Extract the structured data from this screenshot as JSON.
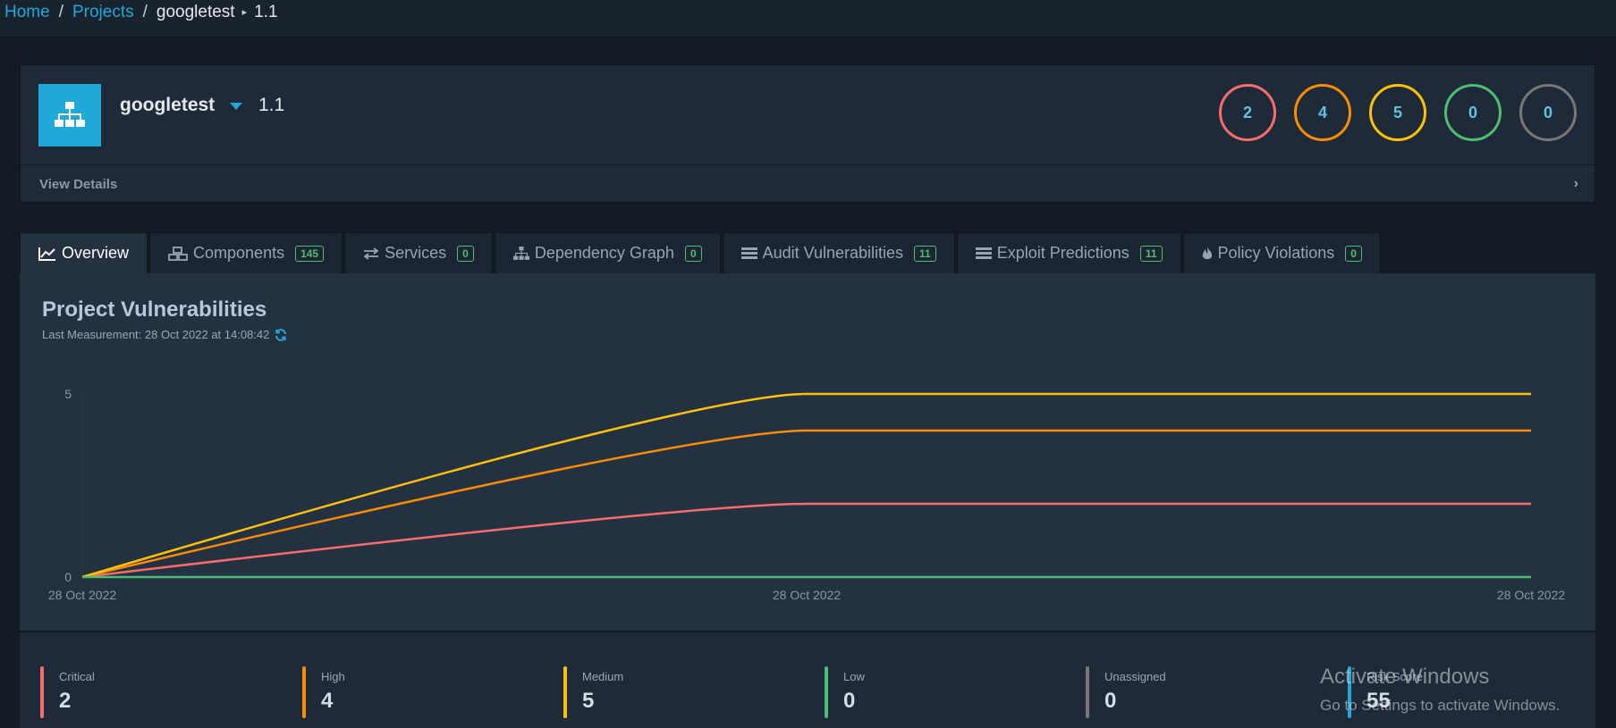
{
  "breadcrumb": {
    "home": "Home",
    "projects": "Projects",
    "project": "googletest",
    "version": "1.1"
  },
  "project": {
    "name": "googletest",
    "version": "1.1",
    "view_details": "View Details",
    "severity_counts": [
      {
        "name": "critical",
        "count": "2",
        "color": "#f86c6b"
      },
      {
        "name": "high",
        "count": "4",
        "color": "#fd8c00"
      },
      {
        "name": "medium",
        "count": "5",
        "color": "#ffc107"
      },
      {
        "name": "low",
        "count": "0",
        "color": "#4dbd74"
      },
      {
        "name": "unassigned",
        "count": "0",
        "color": "#777777"
      }
    ]
  },
  "tabs": [
    {
      "label": "Overview",
      "badge": null,
      "icon": "line-chart-icon",
      "active": true
    },
    {
      "label": "Components",
      "badge": "145",
      "icon": "cubes-icon"
    },
    {
      "label": "Services",
      "badge": "0",
      "icon": "exchange-icon"
    },
    {
      "label": "Dependency Graph",
      "badge": "0",
      "icon": "sitemap-icon"
    },
    {
      "label": "Audit Vulnerabilities",
      "badge": "11",
      "icon": "tasks-icon"
    },
    {
      "label": "Exploit Predictions",
      "badge": "11",
      "icon": "tasks-icon"
    },
    {
      "label": "Policy Violations",
      "badge": "0",
      "icon": "fire-icon"
    }
  ],
  "overview": {
    "title": "Project Vulnerabilities",
    "last_measurement": "Last Measurement: 28 Oct 2022 at 14:08:42"
  },
  "chart_data": {
    "type": "line",
    "x": [
      "28 Oct 2022",
      "28 Oct 2022",
      "28 Oct 2022"
    ],
    "series": [
      {
        "name": "Critical",
        "color": "#f86c6b",
        "values": [
          0,
          2,
          2
        ]
      },
      {
        "name": "High",
        "color": "#fd8c00",
        "values": [
          0,
          4,
          4
        ]
      },
      {
        "name": "Medium",
        "color": "#ffc107",
        "values": [
          0,
          5,
          5
        ]
      },
      {
        "name": "Low",
        "color": "#4dbd74",
        "values": [
          0,
          0,
          0
        ]
      }
    ],
    "yticks": [
      "0",
      "5"
    ],
    "ylim": [
      0,
      5
    ],
    "grid": false,
    "legend": "none"
  },
  "stats": [
    {
      "label": "Critical",
      "value": "2",
      "color": "#f86c6b"
    },
    {
      "label": "High",
      "value": "4",
      "color": "#fd8c00"
    },
    {
      "label": "Medium",
      "value": "5",
      "color": "#ffc107"
    },
    {
      "label": "Low",
      "value": "0",
      "color": "#4dbd74"
    },
    {
      "label": "Unassigned",
      "value": "0",
      "color": "#777777"
    },
    {
      "label": "Risk Score",
      "value": "55",
      "color": "#20a8d8"
    }
  ],
  "watermark": {
    "line1": "Activate Windows",
    "line2": "Go to Settings to activate Windows."
  }
}
